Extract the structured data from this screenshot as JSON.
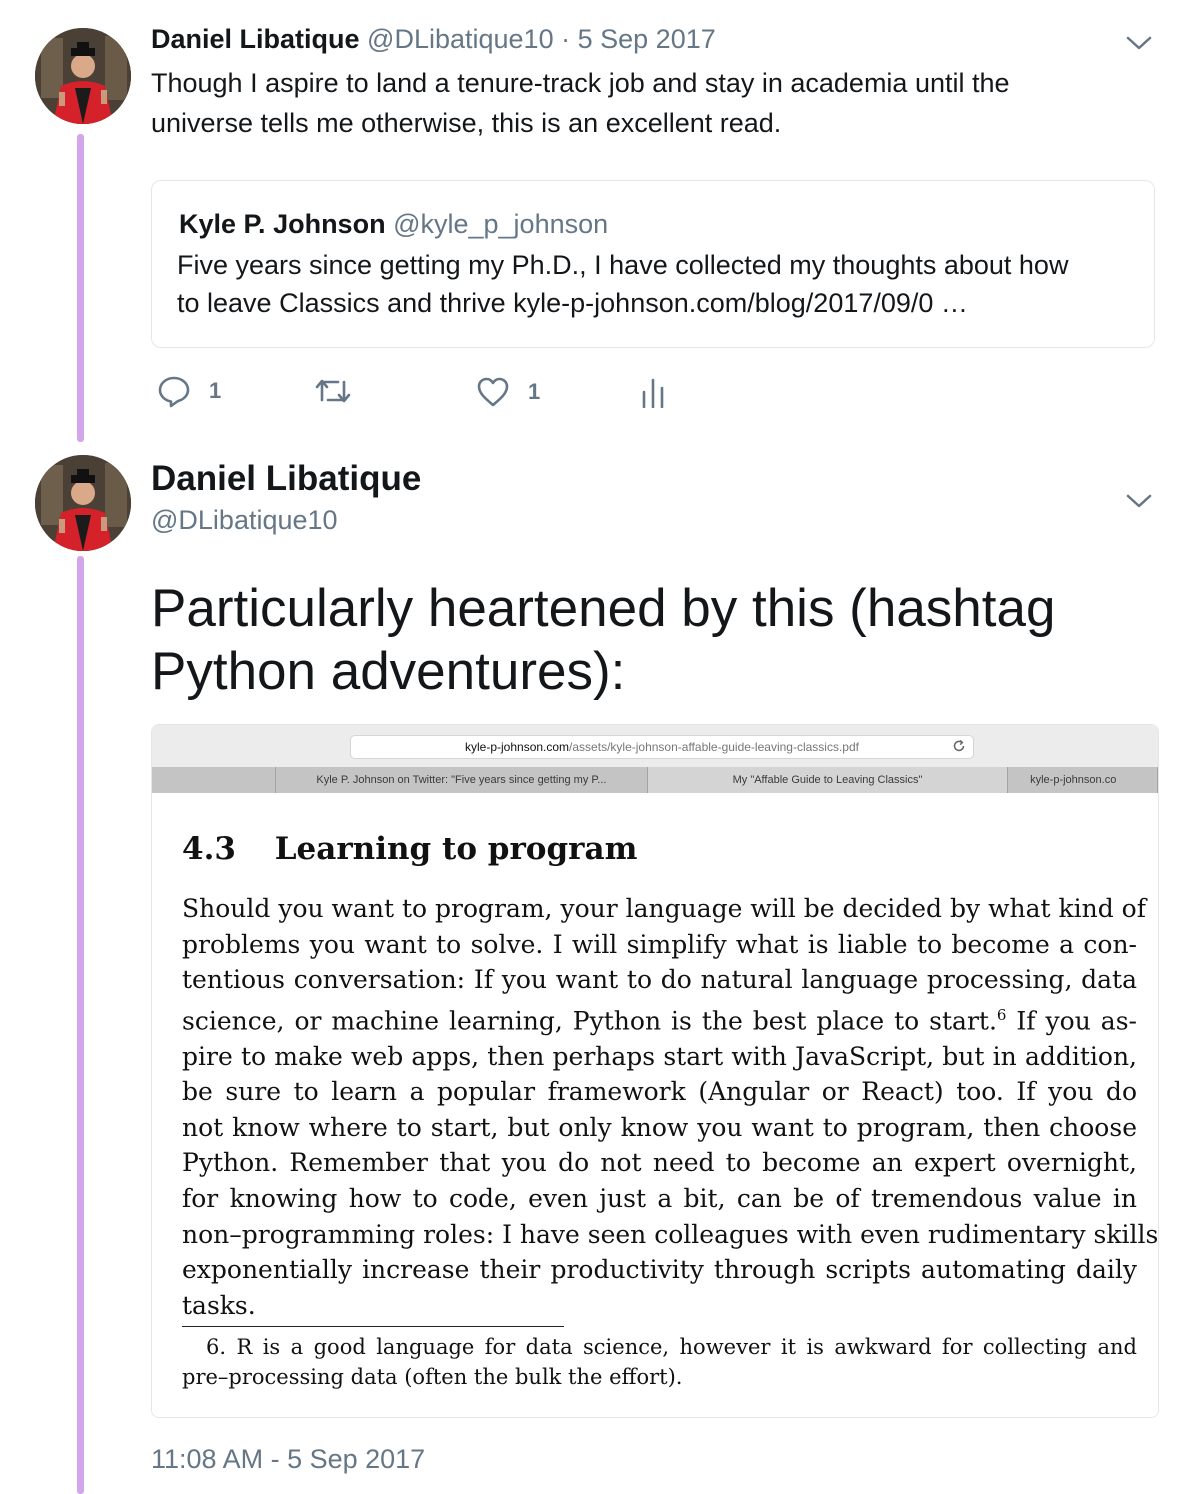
{
  "tweet1": {
    "author_name": "Daniel Libatique",
    "author_handle": "@DLibatique10",
    "separator": "·",
    "date": "5 Sep 2017",
    "text_line1": "Though I aspire to land a tenure-track job and stay in academia until the",
    "text_line2": "universe tells me otherwise, this is an excellent read.",
    "quote": {
      "author_name": "Kyle P. Johnson",
      "author_handle": "@kyle_p_johnson",
      "text_line1": "Five years since getting my Ph.D., I have collected my thoughts about how",
      "text_line2": "to leave Classics and thrive kyle-p-johnson.com/blog/2017/09/0  …"
    },
    "actions": {
      "reply_count": "1",
      "like_count": "1"
    }
  },
  "tweet2": {
    "author_name": "Daniel Libatique",
    "author_handle": "@DLibatique10",
    "text_line1": "Particularly heartened by this (hashtag",
    "text_line2": "Python adventures):",
    "timestamp": "11:08 AM - 5 Sep 2017",
    "media": {
      "url_domain": "kyle-p-johnson.com",
      "url_path": "/assets/kyle-johnson-affable-guide-leaving-classics.pdf",
      "tabs": [
        "Kyle P. Johnson on Twitter: \"Five years since getting my P...",
        "My \"Affable Guide to Leaving Classics\"",
        "kyle-p-johnson.co"
      ],
      "section_number": "4.3",
      "section_title": "Learning to program",
      "paragraph_lines": [
        "Should you want to program, your language will be decided by what kind of",
        "problems you want to solve. I will simplify what is liable to become a con-",
        "tentious conversation: If you want to do natural language processing, data",
        "science, or machine learning, Python is the best place to start.",
        "pire to make web apps, then perhaps start with JavaScript, but in addition,",
        "be sure to learn a popular framework (Angular or React) too. If you do",
        "not know where to start, but only know you want to program, then choose",
        "Python. Remember that you do not need to become an expert overnight,",
        "for knowing how to code, even just a bit, can be of tremendous value in",
        "non–programming roles: I have seen colleagues with even rudimentary skills",
        "exponentially increase their productivity through scripts automating daily",
        "tasks."
      ],
      "footnote_marker": "6",
      "line4_tail": " If you as-",
      "footnote_line1": "6.  R is a good language for data science, however it is awkward for collecting and",
      "footnote_line2": "pre–processing data (often the bulk the effort)."
    }
  },
  "icons": {
    "reply": "reply-icon",
    "retweet": "retweet-icon",
    "like": "heart-icon",
    "analytics": "analytics-icon",
    "menu": "chevron-down-icon",
    "reload": "reload-icon"
  },
  "colors": {
    "thread_line": "#d3a6ec",
    "muted_text": "#657786",
    "border": "#e1e8ed"
  }
}
